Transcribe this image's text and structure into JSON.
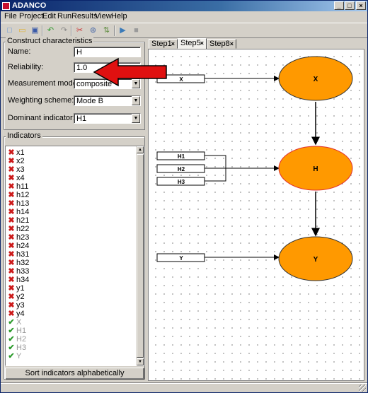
{
  "window": {
    "title": "ADANCO",
    "min_glyph": "_",
    "max_glyph": "□",
    "close_glyph": "×"
  },
  "menu": [
    "File",
    "Project",
    "Edit",
    "Run",
    "Results",
    "View",
    "Help"
  ],
  "toolbar": {
    "buttons": [
      {
        "icon": "new-file-icon",
        "color": "#5b8fd6",
        "glyph": "□"
      },
      {
        "icon": "open-folder-icon",
        "color": "#e0b030",
        "glyph": "▭"
      },
      {
        "icon": "save-icon",
        "color": "#3a5aa8",
        "glyph": "▣"
      },
      {
        "icon": "undo-icon",
        "color": "#2a9a2a",
        "glyph": "↶"
      },
      {
        "icon": "redo-icon",
        "color": "#8a8a8a",
        "glyph": "↷"
      },
      {
        "icon": "delete-icon",
        "color": "#cc3333",
        "glyph": "✂"
      },
      {
        "icon": "zoom-icon",
        "color": "#4a6aa8",
        "glyph": "⊕"
      },
      {
        "icon": "arrange-icon",
        "color": "#5a8a3a",
        "glyph": "⇅"
      },
      {
        "icon": "run-icon",
        "color": "#3a7ab8",
        "glyph": "▶"
      },
      {
        "icon": "results-icon",
        "color": "#9a9a9a",
        "glyph": "■"
      }
    ]
  },
  "construct": {
    "group_title": "Construct characteristics",
    "name_label": "Name:",
    "name_value": "H",
    "reliability_label": "Reliability:",
    "reliability_value": "1.0",
    "measurement_label": "Measurement model:",
    "measurement_value": "composite",
    "weighting_label": "Weighting scheme:",
    "weighting_value": "Mode B",
    "dominant_label": "Dominant indicator:",
    "dominant_value": "H1"
  },
  "indicators": {
    "group_title": "Indicators",
    "items": [
      {
        "label": "x1",
        "state": "red"
      },
      {
        "label": "x2",
        "state": "red"
      },
      {
        "label": "x3",
        "state": "red"
      },
      {
        "label": "x4",
        "state": "red"
      },
      {
        "label": "h11",
        "state": "red"
      },
      {
        "label": "h12",
        "state": "red"
      },
      {
        "label": "h13",
        "state": "red"
      },
      {
        "label": "h14",
        "state": "red"
      },
      {
        "label": "h21",
        "state": "red"
      },
      {
        "label": "h22",
        "state": "red"
      },
      {
        "label": "h23",
        "state": "red"
      },
      {
        "label": "h24",
        "state": "red"
      },
      {
        "label": "h31",
        "state": "red"
      },
      {
        "label": "h32",
        "state": "red"
      },
      {
        "label": "h33",
        "state": "red"
      },
      {
        "label": "h34",
        "state": "red"
      },
      {
        "label": "y1",
        "state": "red"
      },
      {
        "label": "y2",
        "state": "red"
      },
      {
        "label": "y3",
        "state": "red"
      },
      {
        "label": "y4",
        "state": "red"
      },
      {
        "label": "X",
        "state": "green"
      },
      {
        "label": "H1",
        "state": "green"
      },
      {
        "label": "H2",
        "state": "green"
      },
      {
        "label": "H3",
        "state": "green"
      },
      {
        "label": "Y",
        "state": "green"
      }
    ],
    "sort_button": "Sort indicators alphabetically"
  },
  "tabs": [
    {
      "label": "Step1",
      "close": "×",
      "active": false
    },
    {
      "label": "Step5",
      "close": "×",
      "active": true
    },
    {
      "label": "Step8",
      "close": "×",
      "active": false
    }
  ],
  "diagram": {
    "constructs": [
      {
        "label": "X",
        "fill": "#ff9900",
        "stroke": "#333333"
      },
      {
        "label": "H",
        "fill": "#ff9900",
        "stroke": "#e03030"
      },
      {
        "label": "Y",
        "fill": "#ff9900",
        "stroke": "#333333"
      }
    ],
    "indicator_boxes": [
      "X",
      "H1",
      "H2",
      "H3",
      "Y"
    ]
  },
  "colors": {
    "annotation_arrow": "#e01010",
    "title_bar": "#0a246a",
    "check": "#2a9a2a",
    "cross": "#cc1a1a"
  }
}
